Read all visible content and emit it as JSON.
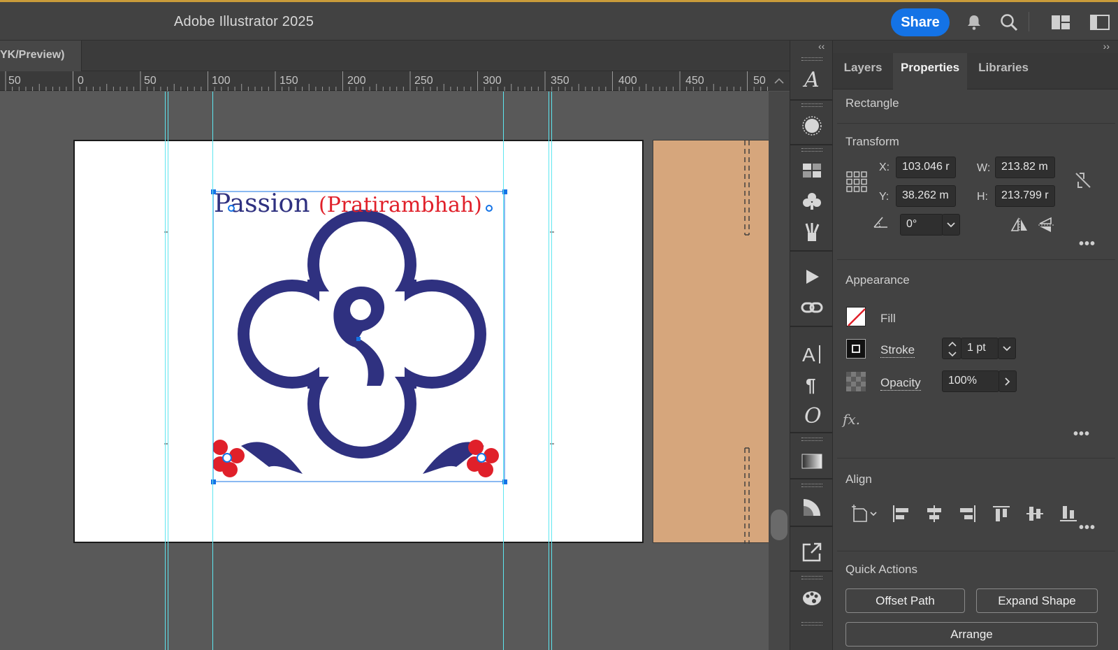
{
  "app": {
    "title": "Adobe Illustrator 2025",
    "share_label": "Share",
    "icons": [
      "bell-icon",
      "search-icon",
      "workspace-icon",
      "panel-toggle-icon"
    ]
  },
  "document": {
    "tab_label": "YK/Preview)"
  },
  "ruler": {
    "ticks": [
      "50",
      "0",
      "50",
      "100",
      "150",
      "200",
      "250",
      "300",
      "350",
      "400",
      "450",
      "50"
    ]
  },
  "artwork": {
    "title_main": "Passion",
    "title_accent": "(Pratirambhah)",
    "colors": {
      "navy": "#2f3180",
      "red": "#e0202a",
      "artboard2": "#d6a67c",
      "guide": "#5ee6f0",
      "accent": "#1473e6"
    }
  },
  "panel": {
    "collapse_left": "‹‹",
    "collapse_right": "››",
    "tabs": [
      "Layers",
      "Properties",
      "Libraries"
    ],
    "active_tab": "Properties",
    "object_type": "Rectangle",
    "transform": {
      "title": "Transform",
      "x_label": "X:",
      "x_value": "103.046 r",
      "y_label": "Y:",
      "y_value": "38.262 m",
      "w_label": "W:",
      "w_value": "213.82 m",
      "h_label": "H:",
      "h_value": "213.799 r",
      "angle_value": "0°"
    },
    "appearance": {
      "title": "Appearance",
      "fill_label": "Fill",
      "stroke_label": "Stroke",
      "stroke_value": "1 pt",
      "opacity_label": "Opacity",
      "opacity_value": "100%",
      "fx_label": "fx."
    },
    "align": {
      "title": "Align"
    },
    "quick_actions": {
      "title": "Quick Actions",
      "offset_path": "Offset Path",
      "expand_shape": "Expand Shape",
      "arrange": "Arrange"
    },
    "more_label": "•••"
  }
}
